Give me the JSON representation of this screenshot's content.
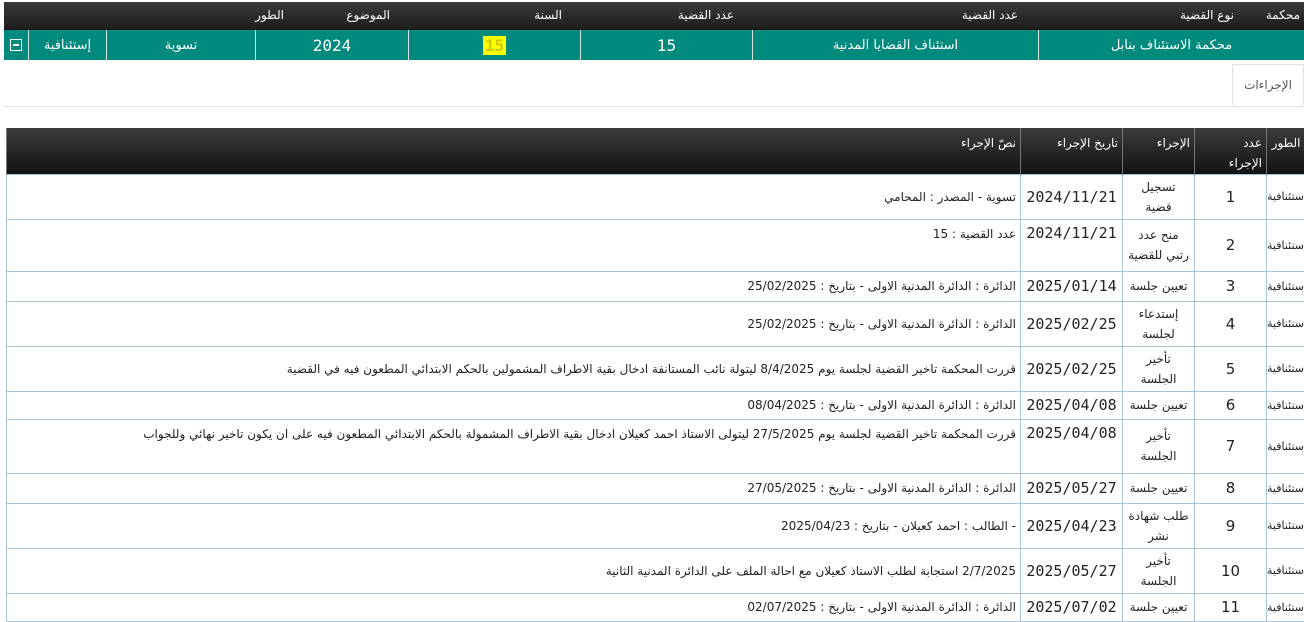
{
  "case_header": {
    "columns": [
      "محكمة",
      "نوع القضية",
      "عدد القضية",
      "عدد القضية",
      "السنة",
      "الموضوع",
      "الطور"
    ],
    "row": {
      "court": "محكمة الاستئناف بنابل",
      "case_type": "استئناف القضايا المدنية",
      "case_number": "15",
      "case_number_highlighted": "15",
      "year": "2024",
      "subject": "تسوية",
      "stage": "إستئنافية"
    }
  },
  "tabs": {
    "procedures": "الإجراءات"
  },
  "procedures": {
    "columns": {
      "stage": "الطور",
      "number_line1": "عدد",
      "number_line2": "الإجراء",
      "action": "الإجراء",
      "date": "تاريخ الإجراء",
      "text": "نصّ الإجراء"
    },
    "rows": [
      {
        "stage": "إستئنافية",
        "number": "1",
        "action": "تسجيل قضية",
        "date": "2024/11/21",
        "text": "تسوية - المصدر : المحامي"
      },
      {
        "stage": "إستئنافية",
        "number": "2",
        "action": "منح عدد رتبي للقضية",
        "date": "2024/11/21",
        "text": "عدد القضية : 15"
      },
      {
        "stage": "إستئنافية",
        "number": "3",
        "action": "تعيين جلسة",
        "date": "2025/01/14",
        "text": "الدائرة : الدائرة المدنية الاولى - بتاريخ : 25/02/2025"
      },
      {
        "stage": "إستئنافية",
        "number": "4",
        "action": "إستدعاء لجلسة",
        "date": "2025/02/25",
        "text": "الدائرة : الدائرة المدنية الاولى - بتاريخ : 25/02/2025"
      },
      {
        "stage": "إستئنافية",
        "number": "5",
        "action": "تأخير الجلسة",
        "date": "2025/02/25",
        "text": "قررت المحكمة تاخير القضية لجلسة يوم 8/4/2025 ليتولة نائب المستانفة ادخال بقية الاطراف المشمولين بالحكم الابتدائي المطعون فيه في القضية"
      },
      {
        "stage": "إستئنافية",
        "number": "6",
        "action": "تعيين جلسة",
        "date": "2025/04/08",
        "text": "الدائرة : الدائرة المدنية الاولى - بتاريخ : 08/04/2025"
      },
      {
        "stage": "إستئنافية",
        "number": "7",
        "action": "تأخير الجلسة",
        "date": "2025/04/08",
        "text": "قررت المحكمة تاخير القضية لجلسة يوم 27/5/2025 ليتولى الاستاذ احمد كعيلان ادخال بقية الاطراف المشمولة بالحكم الابتدائي المطعون فيه على ان يكون تاخير نهائي وللجواب"
      },
      {
        "stage": "إستئنافية",
        "number": "8",
        "action": "تعيين جلسة",
        "date": "2025/05/27",
        "text": "الدائرة : الدائرة المدنية الاولى - بتاريخ : 27/05/2025"
      },
      {
        "stage": "إستئنافية",
        "number": "9",
        "action": "طلب شهادة نشر",
        "date": "2025/04/23",
        "text": "- الطالب : احمد كعيلان - بتاريخ : 2025/04/23"
      },
      {
        "stage": "إستئنافية",
        "number": "10",
        "action": "تأخير الجلسة",
        "date": "2025/05/27",
        "text": "2/7/2025 استجابة لطلب الاستاذ كعيلان مع احالة الملف على الدائرة المدنية الثانية"
      },
      {
        "stage": "إستئنافية",
        "number": "11",
        "action": "تعيين جلسة",
        "date": "2025/07/02",
        "text": "الدائرة : الدائرة المدنية الاولى - بتاريخ : 02/07/2025"
      }
    ]
  },
  "colors": {
    "header_dark": "#1c1c1c",
    "row_teal": "#008a7d",
    "highlight": "#ffff00",
    "grid_border": "#a9c3d8"
  },
  "icons": {
    "collapse": "minus-box-icon"
  }
}
